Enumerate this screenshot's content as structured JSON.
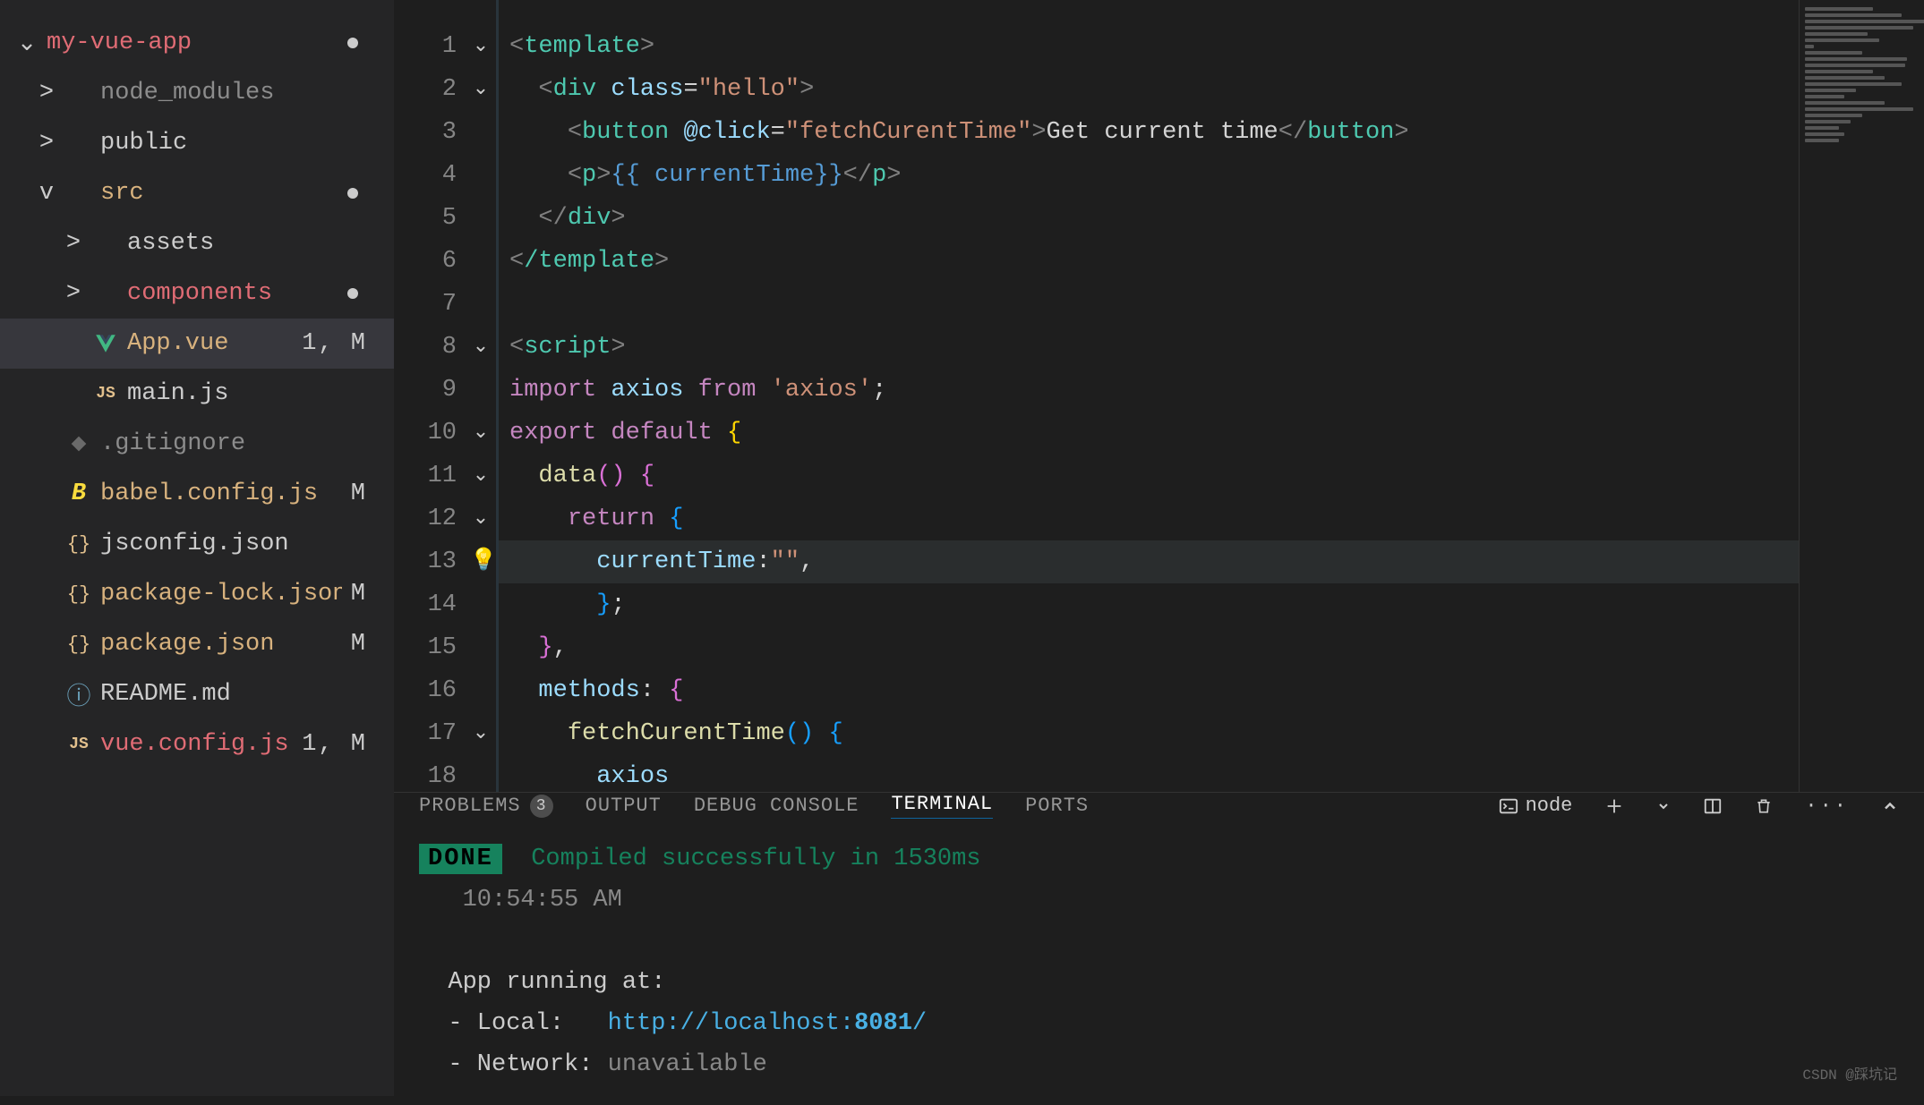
{
  "explorer": {
    "project": "my-vue-app",
    "projectModified": true,
    "items": [
      {
        "label": "node_modules",
        "depth": 1,
        "chev": ">",
        "icon": "folder",
        "color": "clr-dim"
      },
      {
        "label": "public",
        "depth": 1,
        "chev": ">",
        "icon": "folder",
        "color": "clr-normal"
      },
      {
        "label": "src",
        "depth": 1,
        "chev": "v",
        "icon": "folder",
        "color": "clr-modlight",
        "dot": true
      },
      {
        "label": "assets",
        "depth": 2,
        "chev": ">",
        "icon": "folder",
        "color": "clr-normal"
      },
      {
        "label": "components",
        "depth": 2,
        "chev": ">",
        "icon": "folder",
        "color": "clr-mod",
        "dot": true
      },
      {
        "label": "App.vue",
        "depth": 2,
        "icon": "vue",
        "color": "clr-modlight",
        "status": "1, M",
        "active": true
      },
      {
        "label": "main.js",
        "depth": 2,
        "icon": "js",
        "color": "clr-normal"
      },
      {
        "label": ".gitignore",
        "depth": 1,
        "icon": "git",
        "color": "clr-dim"
      },
      {
        "label": "babel.config.js",
        "depth": 1,
        "icon": "babel",
        "color": "clr-modlight",
        "status": "M"
      },
      {
        "label": "jsconfig.json",
        "depth": 1,
        "icon": "json",
        "color": "clr-normal"
      },
      {
        "label": "package-lock.json",
        "depth": 1,
        "icon": "json",
        "color": "clr-modlight",
        "status": "M"
      },
      {
        "label": "package.json",
        "depth": 1,
        "icon": "json",
        "color": "clr-modlight",
        "status": "M"
      },
      {
        "label": "README.md",
        "depth": 1,
        "icon": "info",
        "color": "clr-normal"
      },
      {
        "label": "vue.config.js",
        "depth": 1,
        "icon": "js",
        "color": "clr-mod",
        "status": "1, M"
      }
    ]
  },
  "editor": {
    "lineCount": 18,
    "highlightLine": 13,
    "code": {
      "l1_n": "template",
      "l2_n": "div",
      "l2_a": "class",
      "l2_v": "\"hello\"",
      "l3_n": "button",
      "l3_a": "@click",
      "l3_v": "\"fetchCurentTime\"",
      "l3_t": "Get current time",
      "l4_n": "p",
      "l4_t": "{{ currentTime}}",
      "l6_n": "/template",
      "l8_n": "script",
      "l9_kw": "import",
      "l9_id": "axios",
      "l9_kw2": "from",
      "l9_s": "'axios'",
      "l10_kw": "export",
      "l10_kw2": "default",
      "l11_fn": "data",
      "l12_kw": "return",
      "l13_id": "currentTime",
      "l13_v": "\"\"",
      "l16_id": "methods",
      "l17_fn": "fetchCurentTime",
      "l18_id": "axios"
    }
  },
  "panel": {
    "tabs": {
      "problems": "PROBLEMS",
      "problemsCount": "3",
      "output": "OUTPUT",
      "debug": "DEBUG CONSOLE",
      "terminal": "TERMINAL",
      "ports": "PORTS"
    },
    "shell": "node",
    "terminal": {
      "done": "DONE",
      "compiled": "Compiled successfully in 1530ms",
      "time": "10:54:55 AM",
      "running": "App running at:",
      "localLbl": "- Local:   ",
      "localUrl": "http://localhost:",
      "localPort": "8081",
      "slash": "/",
      "netLbl": "- Network: ",
      "netVal": "unavailable"
    }
  },
  "watermark": "CSDN @踩坑记"
}
